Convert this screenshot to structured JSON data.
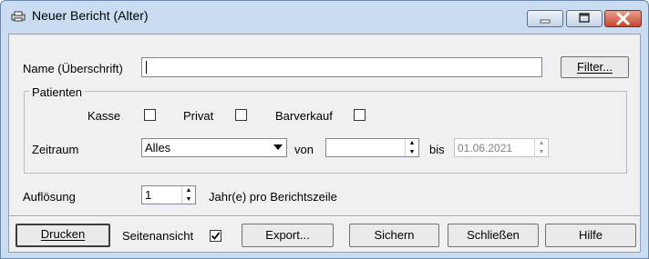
{
  "window": {
    "title": "Neuer Bericht (Alter)"
  },
  "name": {
    "label": "Name (Überschrift)",
    "value": ""
  },
  "filter_button": {
    "label": "Filter...",
    "mnemonic": "F"
  },
  "patienten": {
    "legend": "Patienten",
    "kasse": {
      "label": "Kasse",
      "checked": false
    },
    "privat": {
      "label": "Privat",
      "checked": false
    },
    "barverkauf": {
      "label": "Barverkauf",
      "checked": false
    },
    "zeitraum": {
      "label": "Zeitraum",
      "selected": "Alles",
      "von_label": "von",
      "von_value": "",
      "bis_label": "bis",
      "bis_value": "01.06.2021"
    }
  },
  "aufloesung": {
    "label": "Auflösung",
    "value": "1",
    "suffix": "Jahr(e) pro Berichtszeile"
  },
  "footer": {
    "drucken": "Drucken",
    "seitenansicht_label": "Seitenansicht",
    "seitenansicht_checked": true,
    "export": "Export...",
    "sichern": "Sichern",
    "schliessen": "Schließen",
    "hilfe": "Hilfe"
  }
}
